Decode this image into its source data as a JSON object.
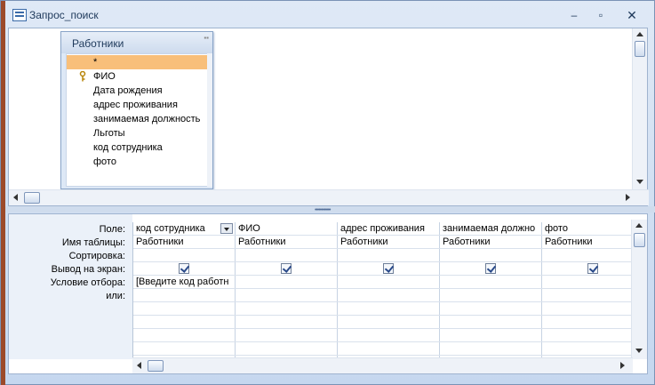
{
  "window": {
    "title": "Запрос_поиск"
  },
  "titlebar_buttons": {
    "minimize": "–",
    "maximize": "▫",
    "close": "✕"
  },
  "table": {
    "title": "Работники",
    "fields": [
      {
        "name": "*",
        "selected": true,
        "key": false
      },
      {
        "name": "ФИО",
        "selected": false,
        "key": true
      },
      {
        "name": "Дата  рождения",
        "selected": false,
        "key": false
      },
      {
        "name": "адрес  проживания",
        "selected": false,
        "key": false
      },
      {
        "name": "занимаемая должность",
        "selected": false,
        "key": false
      },
      {
        "name": "Льготы",
        "selected": false,
        "key": false
      },
      {
        "name": "код сотрудника",
        "selected": false,
        "key": false
      },
      {
        "name": "фото",
        "selected": false,
        "key": false
      }
    ]
  },
  "grid": {
    "row_labels": {
      "field": "Поле:",
      "table": "Имя таблицы:",
      "sort": "Сортировка:",
      "show": "Вывод на экран:",
      "criteria": "Условие отбора:",
      "or": "или:"
    },
    "columns": [
      {
        "field": "код сотрудника",
        "table": "Работники",
        "sort": "",
        "show": true,
        "criteria": "[Введите код работн",
        "or": ""
      },
      {
        "field": "ФИО",
        "table": "Работники",
        "sort": "",
        "show": true,
        "criteria": "",
        "or": ""
      },
      {
        "field": "адрес  проживания",
        "table": "Работники",
        "sort": "",
        "show": true,
        "criteria": "",
        "or": ""
      },
      {
        "field": "занимаемая должно",
        "table": "Работники",
        "sort": "",
        "show": true,
        "criteria": "",
        "or": ""
      },
      {
        "field": "фото",
        "table": "Работники",
        "sort": "",
        "show": true,
        "criteria": "",
        "or": ""
      }
    ]
  },
  "splitter_grip": "••••••••••••"
}
